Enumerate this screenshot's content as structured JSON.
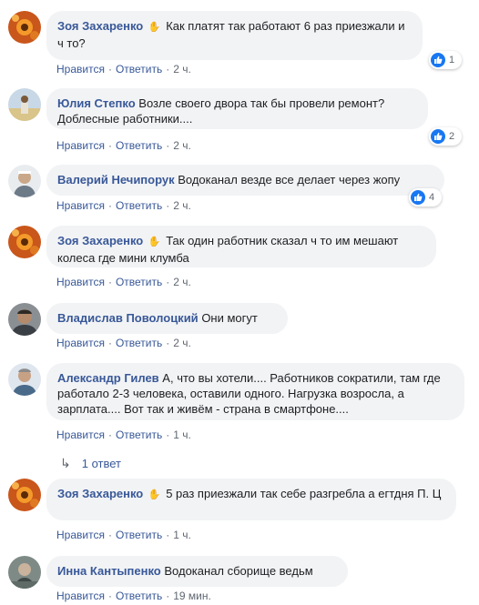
{
  "comments": [
    {
      "author": "Зоя Захаренко",
      "emoji": "👋",
      "text": "Как платят так работают 6 раз приезжали и ч то?",
      "like_label": "Нравится",
      "reply_label": "Ответить",
      "time": "2 ч.",
      "reactions": "1"
    },
    {
      "author": "Юлия Степко",
      "text": "Возле своего двора так бы провели ремонт? Доблесные работники....",
      "like_label": "Нравится",
      "reply_label": "Ответить",
      "time": "2 ч.",
      "reactions": "2"
    },
    {
      "author": "Валерий Нечипорук",
      "text": "Водоканал везде все делает через жопу",
      "like_label": "Нравится",
      "reply_label": "Ответить",
      "time": "2 ч.",
      "reactions": "4"
    },
    {
      "author": "Зоя Захаренко",
      "emoji": "👋",
      "text": "Так один работник сказал ч то им мешают колеса где мини клумба",
      "like_label": "Нравится",
      "reply_label": "Ответить",
      "time": "2 ч."
    },
    {
      "author": "Владислав Поволоцкий",
      "text": "Они могут",
      "like_label": "Нравится",
      "reply_label": "Ответить",
      "time": "2 ч."
    },
    {
      "author": "Александр Гилев",
      "text": "А, что вы хотели.... Работников сократили, там где работало 2-3 человека, оставили одного. Нагрузка возросла, а зарплата.... Вот так и живём - страна в смартфоне....",
      "like_label": "Нравится",
      "reply_label": "Ответить",
      "time": "1 ч.",
      "replies": "1 ответ"
    },
    {
      "author": "Зоя Захаренко",
      "emoji": "👋",
      "text": "5 раз приезжали так себе разгребла а егтдня П. Ц",
      "like_label": "Нравится",
      "reply_label": "Ответить",
      "time": "1 ч."
    },
    {
      "author": "Инна Кантыпенко",
      "text": "Водоканал сборище ведьм",
      "like_label": "Нравится",
      "reply_label": "Ответить",
      "time": "19 мин."
    }
  ],
  "colors": {
    "author_link": "#385898",
    "bubble_bg": "#f2f3f5",
    "like_blue": "#1877f2",
    "meta_gray": "#606770"
  },
  "icons": {
    "like": "thumbs-up-icon",
    "wave": "waving-hand-icon",
    "reply_arrow": "reply-arrow-icon"
  }
}
